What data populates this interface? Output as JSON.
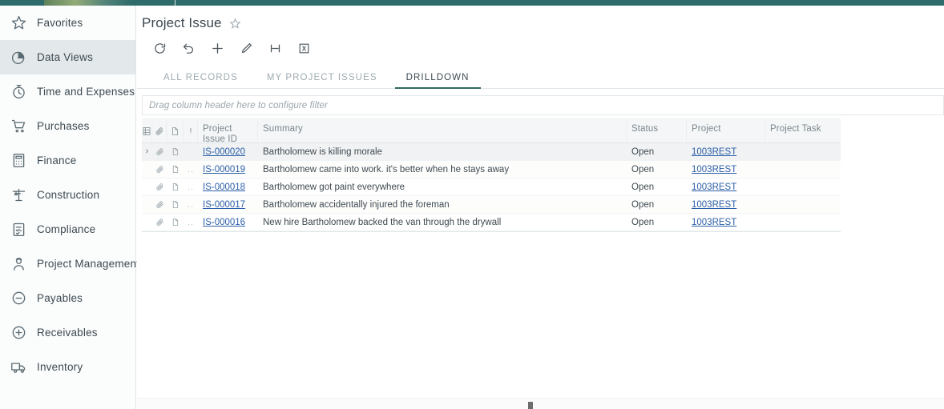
{
  "topbar": {
    "brand_color": "#2e6b6b"
  },
  "sidebar": {
    "items": [
      {
        "label": "Favorites",
        "icon": "star-icon",
        "active": false
      },
      {
        "label": "Data Views",
        "icon": "pie-chart-icon",
        "active": true
      },
      {
        "label": "Time and Expenses",
        "icon": "stopwatch-icon",
        "active": false
      },
      {
        "label": "Purchases",
        "icon": "cart-icon",
        "active": false
      },
      {
        "label": "Finance",
        "icon": "calculator-icon",
        "active": false
      },
      {
        "label": "Construction",
        "icon": "crane-icon",
        "active": false
      },
      {
        "label": "Compliance",
        "icon": "clipboard-icon",
        "active": false
      },
      {
        "label": "Project Management",
        "icon": "worker-icon",
        "active": false
      },
      {
        "label": "Payables",
        "icon": "circle-minus-icon",
        "active": false
      },
      {
        "label": "Receivables",
        "icon": "circle-plus-icon",
        "active": false
      },
      {
        "label": "Inventory",
        "icon": "truck-icon",
        "active": false
      }
    ]
  },
  "header": {
    "title": "Project Issue",
    "favorite_icon": "star-outline-icon"
  },
  "toolbar": {
    "buttons": [
      {
        "name": "refresh-button",
        "icon": "refresh-icon"
      },
      {
        "name": "undo-button",
        "icon": "undo-icon"
      },
      {
        "name": "add-button",
        "icon": "plus-icon"
      },
      {
        "name": "edit-button",
        "icon": "pencil-icon"
      },
      {
        "name": "fit-columns-button",
        "icon": "fit-width-icon"
      },
      {
        "name": "export-excel-button",
        "icon": "excel-icon"
      }
    ]
  },
  "tabs": [
    {
      "label": "ALL RECORDS",
      "active": false
    },
    {
      "label": "MY PROJECT ISSUES",
      "active": false
    },
    {
      "label": "DRILLDOWN",
      "active": true
    }
  ],
  "filter": {
    "placeholder": "Drag column header here to configure filter"
  },
  "grid": {
    "columns": [
      {
        "key": "expand",
        "label": "",
        "icon": "grid-settings-icon"
      },
      {
        "key": "attach",
        "label": "",
        "icon": "paperclip-icon"
      },
      {
        "key": "note",
        "label": "",
        "icon": "note-icon"
      },
      {
        "key": "warn",
        "label": "",
        "icon": "exclamation-icon"
      },
      {
        "key": "id",
        "label": "Project",
        "label2": "Issue ID"
      },
      {
        "key": "summary",
        "label": "Summary"
      },
      {
        "key": "status",
        "label": "Status"
      },
      {
        "key": "project",
        "label": "Project"
      },
      {
        "key": "task",
        "label": "Project Task"
      }
    ],
    "rows": [
      {
        "id": "IS-000020",
        "summary": "Bartholomew is killing morale",
        "status": "Open",
        "project": "1003REST",
        "task": "",
        "selected": true,
        "expanded": false
      },
      {
        "id": "IS-000019",
        "summary": "Bartholomew came into work. it's better when he stays away",
        "status": "Open",
        "project": "1003REST",
        "task": "",
        "selected": false,
        "expanded": false
      },
      {
        "id": "IS-000018",
        "summary": "Bartholomew got paint everywhere",
        "status": "Open",
        "project": "1003REST",
        "task": "",
        "selected": false,
        "expanded": false
      },
      {
        "id": "IS-000017",
        "summary": "Bartholomew accidentally injured the foreman",
        "status": "Open",
        "project": "1003REST",
        "task": "",
        "selected": false,
        "expanded": false
      },
      {
        "id": "IS-000016",
        "summary": "New hire Bartholomew backed the van through the drywall",
        "status": "Open",
        "project": "1003REST",
        "task": "",
        "selected": false,
        "expanded": false
      }
    ]
  }
}
